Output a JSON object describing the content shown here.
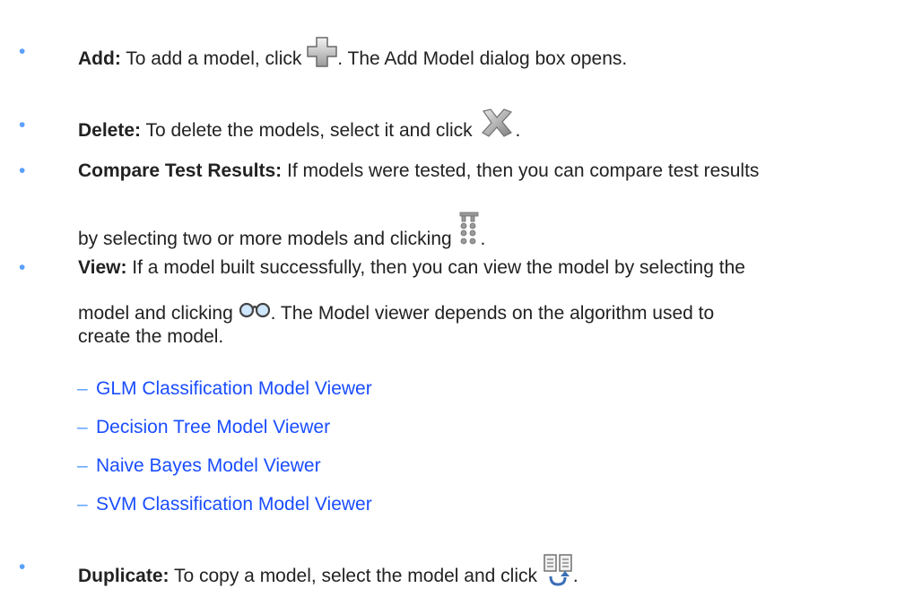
{
  "bullet_symbol": "•",
  "dash_symbol": "–",
  "items": [
    {
      "term": "Add:",
      "before_icon": " To add a model, click ",
      "icon": "add-plus-icon",
      "after_icon": ". The Add Model dialog box opens."
    },
    {
      "term": "Delete:",
      "before_icon": " To delete the models, select it and click ",
      "icon": "delete-x-icon",
      "after_icon": "."
    },
    {
      "term": "Compare Test Results:",
      "line1": " If models were tested, then you can compare test results",
      "line2_before_icon": "by selecting two or more models and clicking ",
      "icon": "compare-test-results-icon",
      "after_icon": "."
    },
    {
      "term": "View:",
      "line1": " If a model built successfully, then you can view the model by selecting the",
      "line2_before_icon": "model and clicking ",
      "icon": "view-glasses-icon",
      "line2_after_icon": ". The Model viewer depends on the algorithm used to",
      "line3": "create the model.",
      "links": [
        "GLM Classification Model Viewer",
        "Decision Tree Model Viewer",
        "Naive Bayes Model Viewer",
        "SVM Classification Model Viewer"
      ]
    },
    {
      "term": "Duplicate:",
      "before_icon": " To copy a model, select the model and click ",
      "icon": "duplicate-icon",
      "after_icon": "."
    }
  ],
  "colors": {
    "bullet": "#5aa0ff",
    "link": "#1a4dff",
    "text": "#222222"
  }
}
